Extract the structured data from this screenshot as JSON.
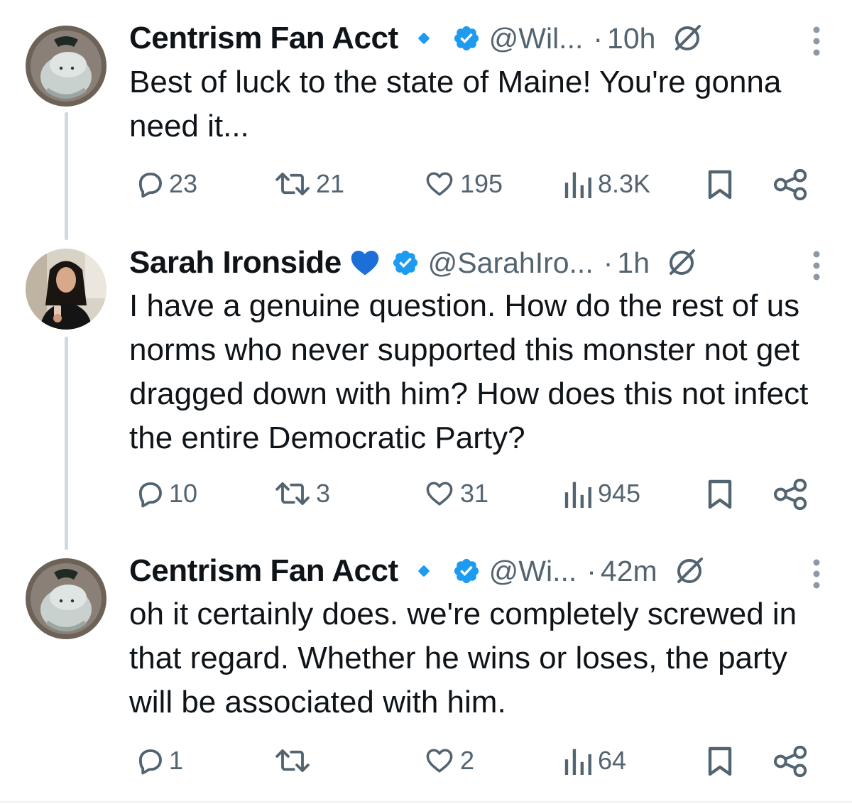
{
  "tweets": [
    {
      "name": "Centrism Fan Acct",
      "name_emoji": "",
      "handle": "@Wil...",
      "separator": "·",
      "time": "10h",
      "text": "Best of luck to the state of Maine! You're gonna need it...",
      "replies": "23",
      "retweets": "21",
      "likes": "195",
      "views": "8.3K"
    },
    {
      "name": "Sarah Ironside",
      "name_emoji": "💙",
      "handle": "@SarahIro...",
      "separator": "·",
      "time": "1h",
      "text": "I have a genuine question. How do the rest of us norms who never supported this monster not get dragged down with him? How does this not infect the entire Democratic Party?",
      "replies": "10",
      "retweets": "3",
      "likes": "31",
      "views": "945"
    },
    {
      "name": "Centrism Fan Acct",
      "name_emoji": "",
      "handle": "@Wi...",
      "separator": "·",
      "time": "42m",
      "text": "oh it certainly does. we're completely screwed in that regard. Whether he wins or loses, the party will be associated with him.",
      "replies": "1",
      "retweets": "",
      "likes": "2",
      "views": "64"
    }
  ],
  "colors": {
    "verified": "#1d9bf0",
    "heart_emoji": "#1d6fd8",
    "secondary_text": "#536471",
    "thread_line": "#cfd9de"
  },
  "icons": [
    "reply-icon",
    "retweet-icon",
    "like-icon",
    "views-icon",
    "bookmark-icon",
    "share-icon",
    "verified-badge-icon",
    "diamond-badge-icon",
    "muted-icon",
    "more-icon"
  ]
}
